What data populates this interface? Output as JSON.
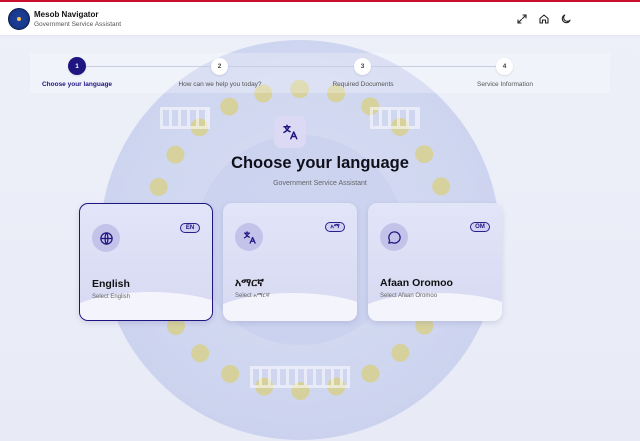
{
  "header": {
    "title": "Mesob Navigator",
    "subtitle": "Government Service Assistant",
    "icons": [
      "fullscreen-icon",
      "home-icon",
      "moon-icon"
    ]
  },
  "stepper": {
    "steps": [
      {
        "number": "1",
        "label": "Choose your language",
        "active": true
      },
      {
        "number": "2",
        "label": "How can we help you today?",
        "active": false
      },
      {
        "number": "3",
        "label": "Required Documents",
        "active": false
      },
      {
        "number": "4",
        "label": "Service Information",
        "active": false
      }
    ]
  },
  "main": {
    "icon": "translate-icon",
    "title": "Choose your language",
    "subtitle": "Government Service Assistant"
  },
  "languages": [
    {
      "name": "English",
      "code": "EN",
      "subtitle": "Select English",
      "icon": "globe-icon",
      "selected": true
    },
    {
      "name": "አማርኛ",
      "code": "አማ",
      "subtitle": "Select አማርኛ",
      "icon": "translate-icon",
      "selected": false
    },
    {
      "name": "Afaan Oromoo",
      "code": "OM",
      "subtitle": "Select Afaan Oromoo",
      "icon": "message-icon",
      "selected": false
    }
  ],
  "colors": {
    "accent": "#1f1580",
    "top_border": "#c8102e",
    "background": "#e8eaf6"
  }
}
